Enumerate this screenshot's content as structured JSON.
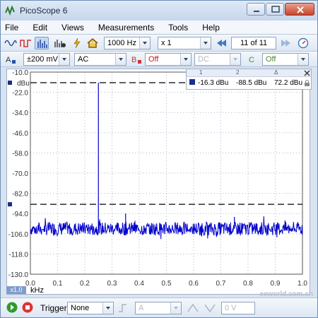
{
  "window": {
    "title": "PicoScope 6"
  },
  "menu": [
    "File",
    "Edit",
    "Views",
    "Measurements",
    "Tools",
    "Help"
  ],
  "toolbar1": {
    "frequency": "1000 Hz",
    "zoom": "x 1",
    "capture_counter": "11 of 11"
  },
  "toolbar2": {
    "channel_letter": "A",
    "range": "±200 mV",
    "coupling": "AC",
    "off_a": "Off",
    "coupling_b": "DC",
    "off_b": "Off"
  },
  "scope": {
    "y_unit": "dBu",
    "x_unit": "kHz",
    "scale_label": "x1.0",
    "y_ticks": [
      "-10.0",
      "-22.0",
      "-34.0",
      "-46.0",
      "-58.0",
      "-70.0",
      "-82.0",
      "-94.0",
      "-106.0",
      "-118.0",
      "-130.0"
    ],
    "x_ticks": [
      "0.0",
      "0.1",
      "0.2",
      "0.3",
      "0.4",
      "0.5",
      "0.6",
      "0.7",
      "0.8",
      "0.9",
      "1.0"
    ]
  },
  "measurement": {
    "col1": "1",
    "col2": "2",
    "col3": "Δ",
    "value1": "-16.3 dBu",
    "value2": "-88.5 dBu",
    "delta": "72.2 dBu"
  },
  "chart_data": {
    "type": "line",
    "title": "",
    "xlabel": "kHz",
    "ylabel": "dBu",
    "xlim": [
      0.0,
      1.0
    ],
    "ylim": [
      -130.0,
      -10.0
    ],
    "grid": true,
    "noise_floor": -103.0,
    "peaks": [
      {
        "x": 0.25,
        "y": -16.3
      },
      {
        "x": 0.35,
        "y": -94.0
      },
      {
        "x": 0.75,
        "y": -96.0
      }
    ],
    "rulers": [
      -16.3,
      -88.5
    ]
  },
  "bottombar": {
    "trigger_label": "Trigger",
    "trigger_mode": "None",
    "channel": "A",
    "voltage": "0 V"
  },
  "colors": {
    "trace": "#0000cc",
    "grid": "#a9b8cc",
    "ruler": "#000000"
  },
  "watermark": "eeworld.com.cn"
}
